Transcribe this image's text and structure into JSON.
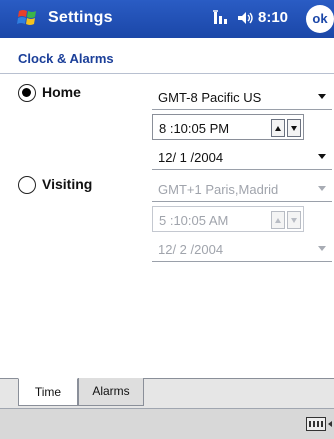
{
  "titlebar": {
    "title": "Settings",
    "time": "8:10",
    "ok_label": "ok"
  },
  "page": {
    "title": "Clock & Alarms"
  },
  "home": {
    "label": "Home",
    "selected": true,
    "timezone": "GMT-8 Pacific US",
    "time": "8 :10:05 PM",
    "date": "12/ 1 /2004"
  },
  "visiting": {
    "label": "Visiting",
    "selected": false,
    "timezone": "GMT+1 Paris,Madrid",
    "time": "5 :10:05 AM",
    "date": "12/ 2 /2004"
  },
  "tabs": [
    {
      "label": "Time",
      "active": true
    },
    {
      "label": "Alarms",
      "active": false
    }
  ],
  "colors": {
    "titlebar": "#1b47a8",
    "page_title": "#1b3f99",
    "disabled_text": "#a0a4ac"
  },
  "icons": {
    "start": "windows-flag-icon",
    "antenna": "antenna-icon",
    "volume": "speaker-icon",
    "keyboard": "keyboard-icon"
  }
}
